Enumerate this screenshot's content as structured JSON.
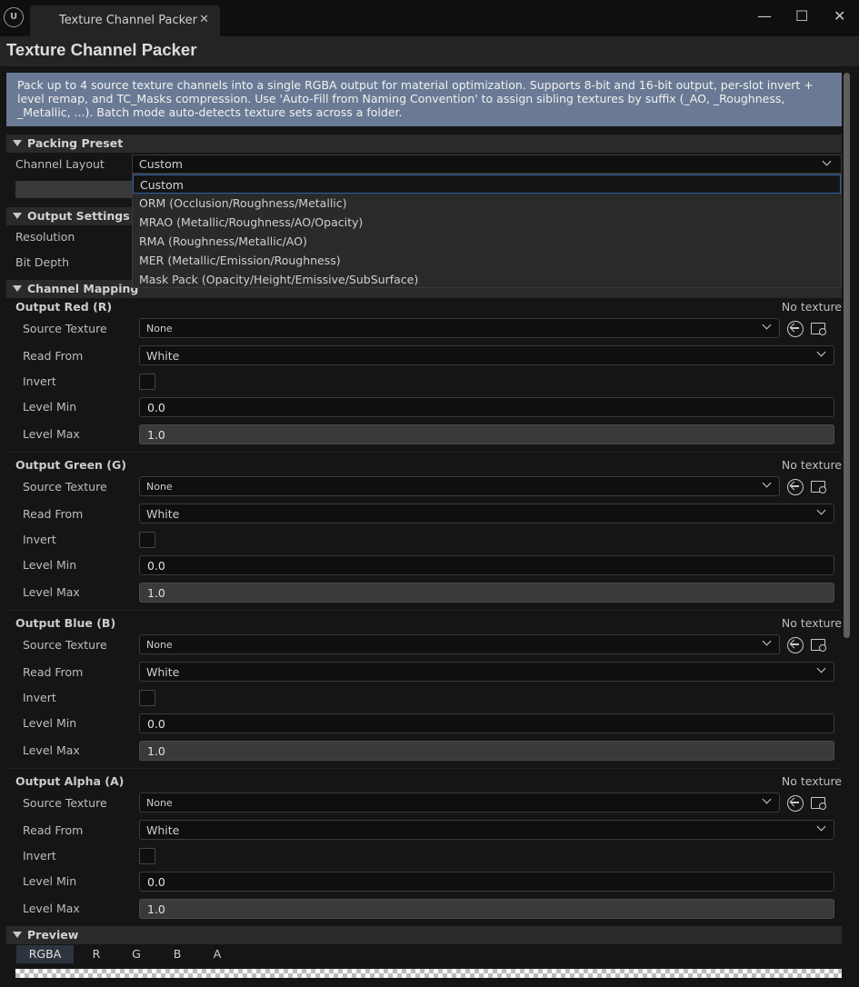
{
  "window": {
    "tab_label": "Texture Channel Packer",
    "close_glyph": "✕",
    "minimize_glyph": "—",
    "maximize_glyph": "☐",
    "close_window_glyph": "✕"
  },
  "header": {
    "title": "Texture Channel Packer"
  },
  "info": {
    "text": "Pack up to 4 source texture channels into a single RGBA output for material optimization. Supports 8-bit and 16-bit output, per-slot invert + level remap, and TC_Masks compression. Use 'Auto-Fill from Naming Convention' to assign sibling textures by suffix (_AO, _Roughness, _Metallic, ...). Batch mode auto-detects texture sets across a folder."
  },
  "packing_preset": {
    "section_label": "Packing Preset",
    "channel_layout_label": "Channel Layout",
    "channel_layout_value": "Custom",
    "options": [
      "Custom",
      "ORM (Occlusion/Roughness/Metallic)",
      "MRAO (Metallic/Roughness/AO/Opacity)",
      "RMA (Roughness/Metallic/AO)",
      "MER (Metallic/Emission/Roughness)",
      "Mask Pack (Opacity/Height/Emissive/SubSurface)"
    ]
  },
  "output_settings": {
    "section_label": "Output Settings",
    "resolution_label": "Resolution",
    "bit_depth_label": "Bit Depth"
  },
  "channel_mapping": {
    "section_label": "Channel Mapping",
    "labels": {
      "source": "Source Texture",
      "read": "Read From",
      "invert": "Invert",
      "min": "Level Min",
      "max": "Level Max"
    },
    "channels": [
      {
        "title": "Output Red (R)",
        "status": "No texture",
        "source": "None",
        "read_from": "White",
        "level_min": "0.0",
        "level_max": "1.0"
      },
      {
        "title": "Output Green (G)",
        "status": "No texture",
        "source": "None",
        "read_from": "White",
        "level_min": "0.0",
        "level_max": "1.0"
      },
      {
        "title": "Output Blue (B)",
        "status": "No texture",
        "source": "None",
        "read_from": "White",
        "level_min": "0.0",
        "level_max": "1.0"
      },
      {
        "title": "Output Alpha (A)",
        "status": "No texture",
        "source": "None",
        "read_from": "White",
        "level_min": "0.0",
        "level_max": "1.0"
      }
    ]
  },
  "preview": {
    "section_label": "Preview",
    "tabs": [
      "RGBA",
      "R",
      "G",
      "B",
      "A"
    ],
    "active_tab": "RGBA"
  },
  "colors": {
    "info_bg": "#6a7a94",
    "selection_border": "#2f5fa8",
    "panel_bg": "#151515"
  }
}
